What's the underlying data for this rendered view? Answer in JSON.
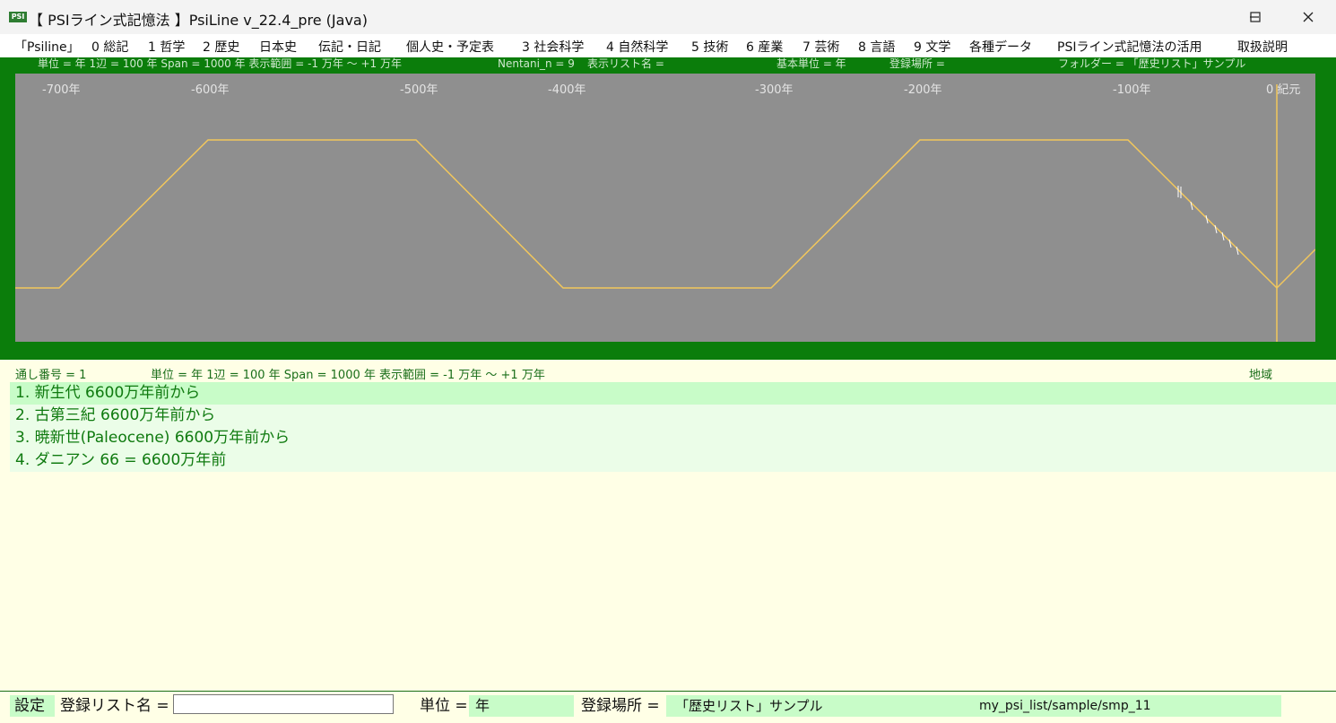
{
  "window": {
    "title": "【 PSIライン式記憶法 】PsiLine v_22.4_pre (Java)",
    "icon_text": "PSI",
    "minimize_icon": "minimize-icon",
    "maximize_icon": "maximize-icon",
    "close_icon": "close-icon"
  },
  "menu": [
    "「Psiline」",
    "0 総記",
    "1 哲学",
    "2 歴史",
    "日本史",
    "伝記・日記",
    "個人史・予定表",
    "3 社会科学",
    "4 自然科学",
    "5 技術",
    "6 産業",
    "7 芸術",
    "8 言語",
    "9 文学",
    "各種データ",
    "PSIライン式記憶法の活用",
    "取扱説明"
  ],
  "graph": {
    "info_unit": "単位 = 年  1辺 = 100 年  Span = 1000 年  表示範囲 = -1 万年 〜 +1 万年",
    "info_nentani": "Nentani_n = 9",
    "info_listname": "表示リスト名 =",
    "info_base_unit": "基本単位 = 年",
    "info_location": "登録場所 =",
    "info_folder": "フォルダー = 「歴史リスト」サンプル",
    "tick_labels": [
      "-700年",
      "-600年",
      "-500年",
      "-400年",
      "-300年",
      "-200年",
      "-100年",
      "0 紀元"
    ],
    "colors": {
      "panel_bg": "#0b7d0b",
      "plot_bg": "#8f8f8f",
      "line": "#f2c75c",
      "marker": "#ffffff"
    }
  },
  "list": {
    "header_serial": "通し番号 = 1",
    "header_info": "単位 = 年  1辺 = 100 年  Span = 1000 年  表示範囲 = -1 万年 〜 +1 万年",
    "header_region": "地域",
    "items": [
      "1. 新生代 6600万年前から",
      "2. 古第三紀 6600万年前から",
      "3. 暁新世(Paleocene) 6600万年前から",
      "4. ダニアン 66 = 6600万年前"
    ],
    "colors": {
      "selected_bg": "#c8fcc8",
      "item_bg": "#ebfde8",
      "text": "#0f7a0f"
    }
  },
  "status": {
    "settings_label": "設定",
    "listname_label": "登録リスト名 =",
    "listname_value": "",
    "unit_label": "単位 =",
    "unit_value": "年",
    "location_label": "登録場所 =",
    "location_value": "「歴史リスト」サンプル",
    "path_value": "my_psi_list/sample/smp_11"
  }
}
